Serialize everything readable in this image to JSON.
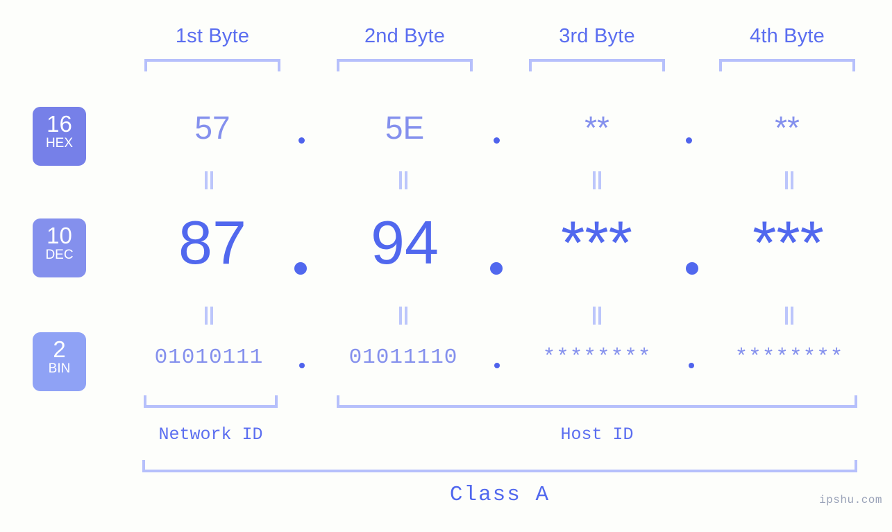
{
  "watermark": "ipshu.com",
  "byte_headers": [
    {
      "label": "1st Byte"
    },
    {
      "label": "2nd Byte"
    },
    {
      "label": "3rd Byte"
    },
    {
      "label": "4th Byte"
    }
  ],
  "bases": [
    {
      "number": "16",
      "name": "HEX",
      "color": "#7680e8"
    },
    {
      "number": "10",
      "name": "DEC",
      "color": "#8490ed"
    },
    {
      "number": "2",
      "name": "BIN",
      "color": "#8fa2f5"
    }
  ],
  "rows": {
    "hex": {
      "values": [
        "57",
        "5E",
        "**",
        "**"
      ],
      "separator": "."
    },
    "dec": {
      "values": [
        "87",
        "94",
        "***",
        "***"
      ],
      "separator": "."
    },
    "bin": {
      "values": [
        "01010111",
        "01011110",
        "********",
        "********"
      ],
      "separator": "."
    }
  },
  "connector_symbol": "||",
  "segments": {
    "network_id": "Network ID",
    "host_id": "Host ID"
  },
  "class_label": "Class A",
  "colors": {
    "background": "#fdfefb",
    "accent": "#5168ee",
    "accent_light": "#8490ed",
    "bracket": "#b6c0fb",
    "badge_hex": "#7680e8",
    "badge_dec": "#8490ed",
    "badge_bin": "#8fa2f5",
    "watermark": "#9aa3b8"
  }
}
